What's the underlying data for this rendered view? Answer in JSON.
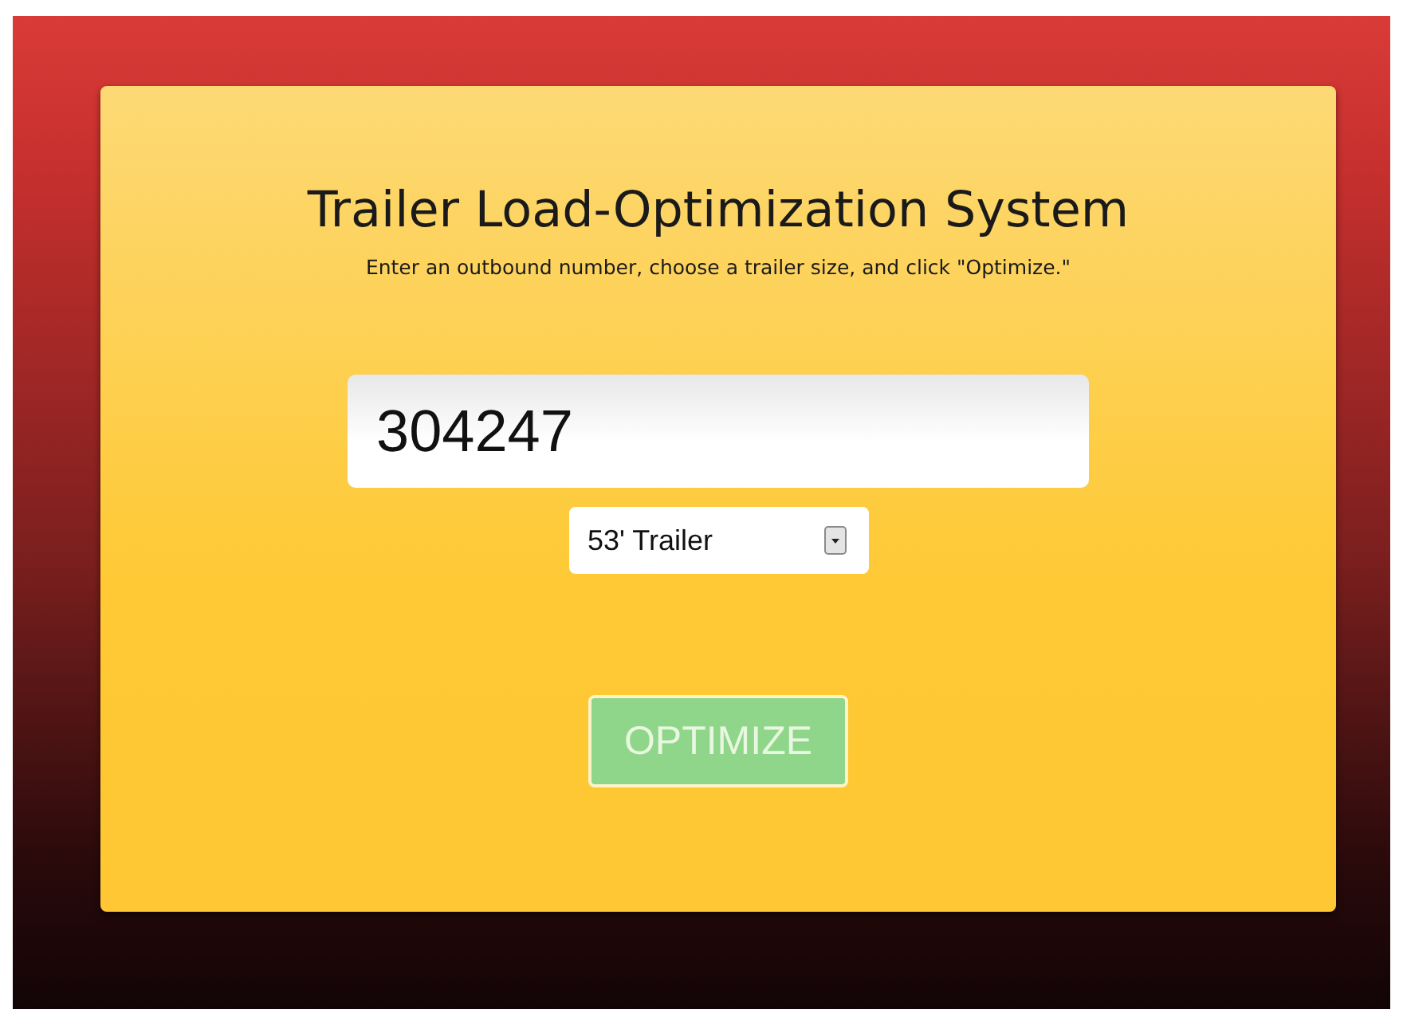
{
  "title": "Trailer Load-Optimization System",
  "instructions": "Enter an outbound number, choose a trailer size, and click \"Optimize.\"",
  "outbound_field": {
    "value": "304247"
  },
  "trailer_select": {
    "value": "53' Trailer"
  },
  "optimize_button": {
    "label": "OPTIMIZE",
    "disabled": true
  }
}
